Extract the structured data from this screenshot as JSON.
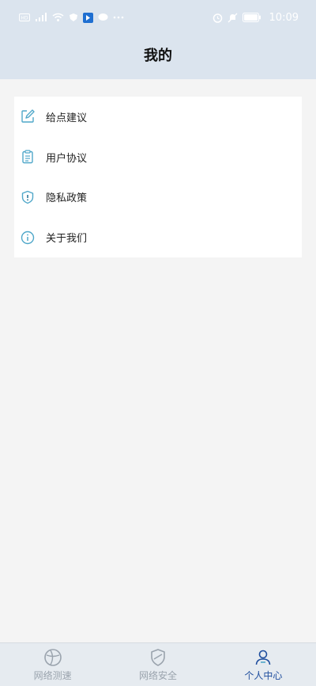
{
  "status_bar": {
    "time": "10:09",
    "left_icons": [
      "hd-icon",
      "signal-icon",
      "wifi-icon",
      "shield-icon",
      "app-icon",
      "message-icon",
      "more-dots-icon"
    ],
    "right_icons": [
      "alarm-icon",
      "mute-icon",
      "battery-icon"
    ]
  },
  "header": {
    "title": "我的"
  },
  "menu": {
    "items": [
      {
        "label": "给点建议",
        "icon": "edit-icon"
      },
      {
        "label": "用户协议",
        "icon": "clipboard-icon"
      },
      {
        "label": "隐私政策",
        "icon": "shield-alert-icon"
      },
      {
        "label": "关于我们",
        "icon": "info-icon"
      }
    ]
  },
  "tabs": [
    {
      "label": "网络测速",
      "icon": "speedtest-icon",
      "active": false
    },
    {
      "label": "网络安全",
      "icon": "security-icon",
      "active": false
    },
    {
      "label": "个人中心",
      "icon": "person-icon",
      "active": true
    }
  ],
  "colors": {
    "accent": "#4fa7c9",
    "active_tab": "#1f4e9e",
    "inactive_tab": "#9aa3ad",
    "header_bg": "#dbe4ee"
  }
}
